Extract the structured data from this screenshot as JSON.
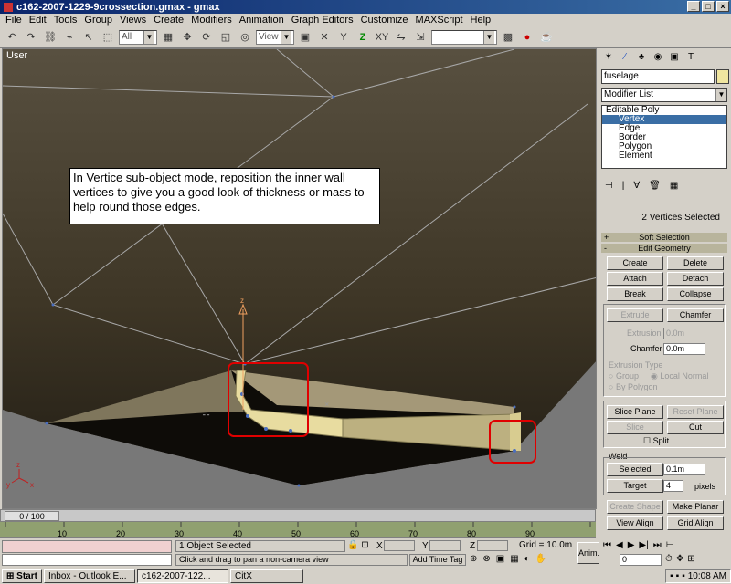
{
  "window": {
    "title": "c162-2007-1229-9crossection.gmax - gmax"
  },
  "menu": [
    "File",
    "Edit",
    "Tools",
    "Group",
    "Views",
    "Create",
    "Modifiers",
    "Animation",
    "Graph Editors",
    "Customize",
    "MAXScript",
    "Help"
  ],
  "toolbar": {
    "filter": "All",
    "refcoord": "View",
    "named_sel": ""
  },
  "viewport": {
    "label": "User",
    "note": "In Vertice sub-object mode, reposition the inner wall vertices to give you a good look of thickness or mass to help round those edges."
  },
  "cmd": {
    "object_name": "fuselage",
    "modifier_list": "Modifier List",
    "stack": [
      {
        "label": "Editable Poly",
        "sub": false,
        "sel": false
      },
      {
        "label": "Vertex",
        "sub": true,
        "sel": true
      },
      {
        "label": "Edge",
        "sub": true,
        "sel": false
      },
      {
        "label": "Border",
        "sub": true,
        "sel": false
      },
      {
        "label": "Polygon",
        "sub": true,
        "sel": false
      },
      {
        "label": "Element",
        "sub": true,
        "sel": false
      }
    ],
    "selection_info": "2 Vertices Selected",
    "soft_selection": "Soft Selection",
    "edit_geometry": "Edit Geometry",
    "buttons": {
      "create": "Create",
      "delete": "Delete",
      "attach": "Attach",
      "detach": "Detach",
      "break": "Break",
      "collapse": "Collapse",
      "extrude": "Extrude",
      "chamfer": "Chamfer",
      "slice_plane": "Slice Plane",
      "reset_plane": "Reset Plane",
      "slice": "Slice",
      "cut": "Cut",
      "weld_selected": "Selected",
      "weld_target": "Target",
      "create_shape": "Create Shape",
      "make_planar": "Make Planar",
      "view_align": "View Align",
      "grid_align": "Grid Align"
    },
    "labels": {
      "extrusion": "Extrusion",
      "chamfer": "Chamfer",
      "extrusion_type": "Extrusion Type",
      "group": "Group",
      "local_normal": "Local Normal",
      "by_polygon": "By Polygon",
      "split": "Split",
      "weld": "Weld",
      "pixels": "pixels"
    },
    "values": {
      "extrusion": "0.0m",
      "chamfer": "0.0m",
      "weld_selected": "0.1m",
      "weld_target": "4"
    }
  },
  "timeline": {
    "slider": "0 / 100",
    "ticks": [
      "10",
      "20",
      "30",
      "40",
      "50",
      "60",
      "70",
      "80",
      "90"
    ]
  },
  "status": {
    "objects": "1 Object Selected",
    "prompt": "Click and drag to pan a non-camera view",
    "x": "X",
    "y": "Y",
    "z": "Z",
    "grid": "Grid = 10.0m",
    "add_time_tag": "Add Time Tag",
    "anim": "Anim.",
    "frame": "0"
  },
  "taskbar": {
    "start": "Start",
    "items": [
      "Inbox - Outlook E...",
      "c162-2007-122...",
      "CitX"
    ],
    "clock": "10:08 AM"
  },
  "colors": {
    "title_start": "#0a246a",
    "title_end": "#3a6ea5",
    "viewport_top": "#5a5040",
    "viewport_bottom": "#2a2418",
    "ground": "#787878",
    "mesh_face": "#e8dca0"
  }
}
